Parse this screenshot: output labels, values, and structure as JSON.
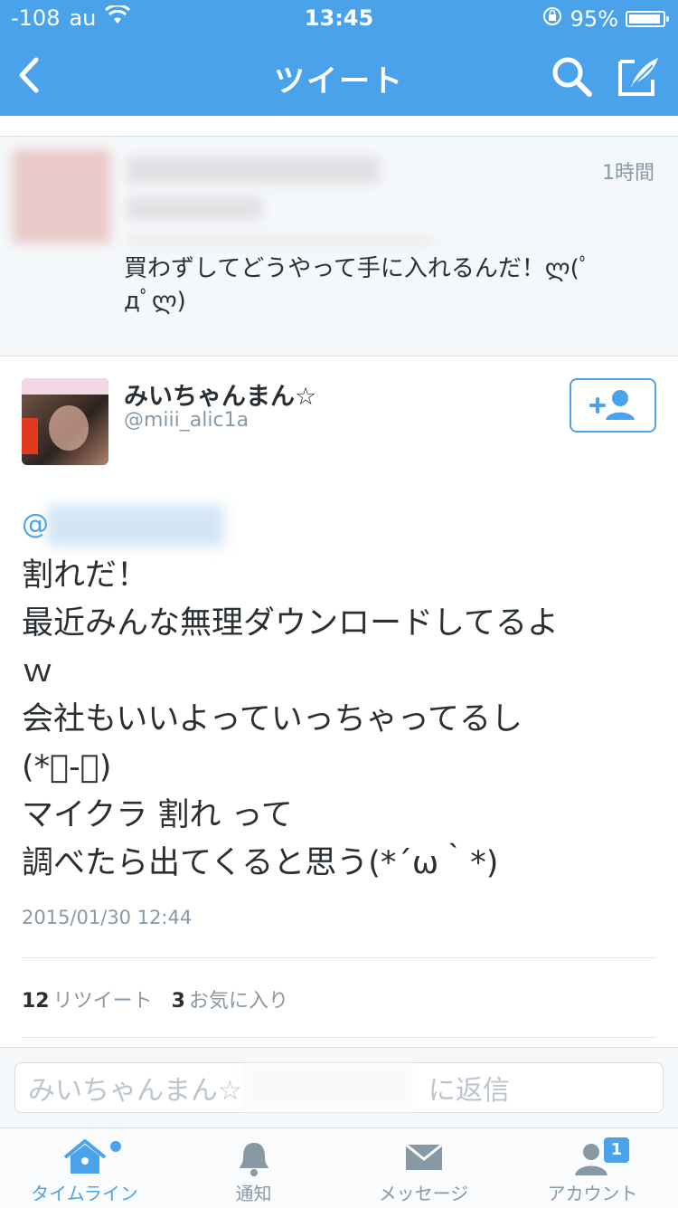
{
  "status_bar": {
    "signal": "-108",
    "carrier": "au",
    "time": "13:45",
    "battery": "95%",
    "battery_level": 0.95
  },
  "nav": {
    "title": "ツイート"
  },
  "previous_tweet": {
    "time": "1時間",
    "text_lines": [
      "買わずしてどうやって手に入れるんだ！ლ(ﾟ",
      "дﾟლ)"
    ]
  },
  "tweet": {
    "display_name": "みいちゃんまん☆",
    "handle": "@miii_alic1a",
    "mention_prefix": "@",
    "body_lines": [
      "割れだ！",
      "最近みんな無理ダウンロードしてるよ",
      "ｗ",
      "会社もいいよっていっちゃってるし",
      "(*ﾟ-ﾟ)",
      "マイクラ 割れ って",
      "調べたら出てくると思う(*´ω｀*)"
    ],
    "date": "2015/01/30 12:44",
    "retweet_count": "12",
    "retweet_label": "リツイート",
    "favorite_count": "3",
    "favorite_label": "お気に入り"
  },
  "reply": {
    "placeholder_start": "みいちゃんまん☆",
    "placeholder_end": "に返信"
  },
  "tabs": [
    {
      "label": "タイムライン",
      "icon": "home-icon"
    },
    {
      "label": "通知",
      "icon": "bell-icon"
    },
    {
      "label": "メッセージ",
      "icon": "envelope-icon"
    },
    {
      "label": "アカウント",
      "icon": "account-icon",
      "badge": "1"
    }
  ],
  "colors": {
    "brand": "#4aa3ea",
    "muted": "#8899a6",
    "text": "#292f33"
  }
}
